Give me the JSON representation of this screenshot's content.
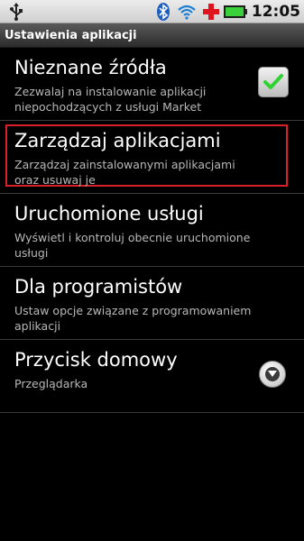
{
  "status_bar": {
    "time": "12:05",
    "icons": [
      "usb-icon",
      "bluetooth-icon",
      "wifi-icon",
      "red-cross-icon",
      "battery-icon"
    ]
  },
  "header": {
    "title": "Ustawienia aplikacji"
  },
  "settings": [
    {
      "title": "Nieznane źródła",
      "summary": "Zezwalaj na instalowanie aplikacji niepochodzących z usługi Market",
      "control": "checkbox",
      "checked": true
    },
    {
      "title": "Zarządzaj aplikacjami",
      "summary": "Zarządzaj zainstalowanymi aplikacjami oraz usuwaj je",
      "highlighted": true
    },
    {
      "title": "Uruchomione usługi",
      "summary": "Wyświetl i kontroluj obecnie uruchomione usługi"
    },
    {
      "title": "Dla programistów",
      "summary": "Ustaw opcje związane z programowaniem aplikacji"
    },
    {
      "title": "Przycisk domowy",
      "summary": "Przeglądarka",
      "control": "dropdown"
    }
  ],
  "colors": {
    "highlight_border": "#d8202a",
    "checkbox_check": "#2fd32f",
    "background": "#000000"
  }
}
